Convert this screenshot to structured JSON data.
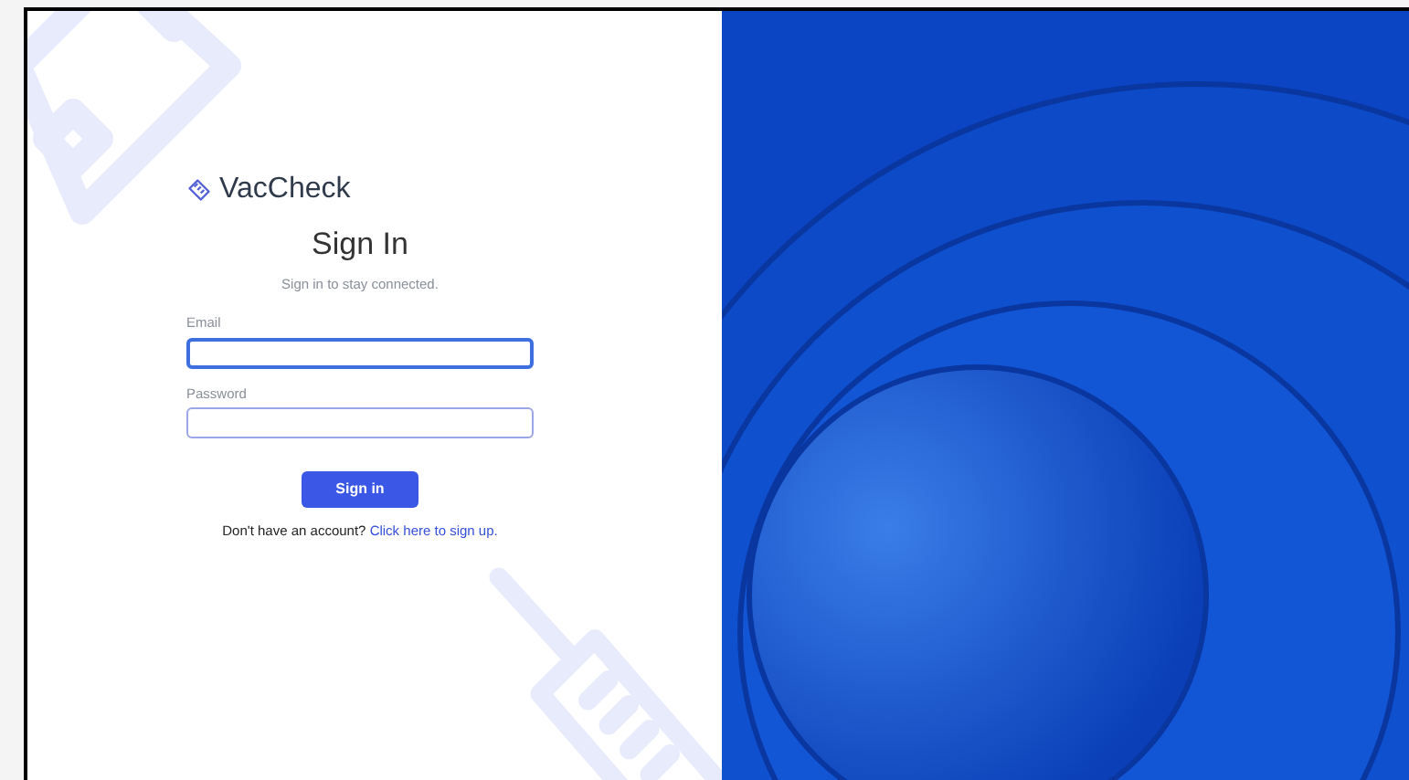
{
  "brand": {
    "name": "VacCheck"
  },
  "form": {
    "title": "Sign In",
    "subtitle": "Sign in to stay connected.",
    "fields": [
      {
        "label": "Email",
        "focused": true
      },
      {
        "label": "Password",
        "focused": false
      }
    ],
    "submit": "Sign in",
    "signup": {
      "prompt": "Don't have an account?",
      "link": "Click here to sign up."
    }
  }
}
